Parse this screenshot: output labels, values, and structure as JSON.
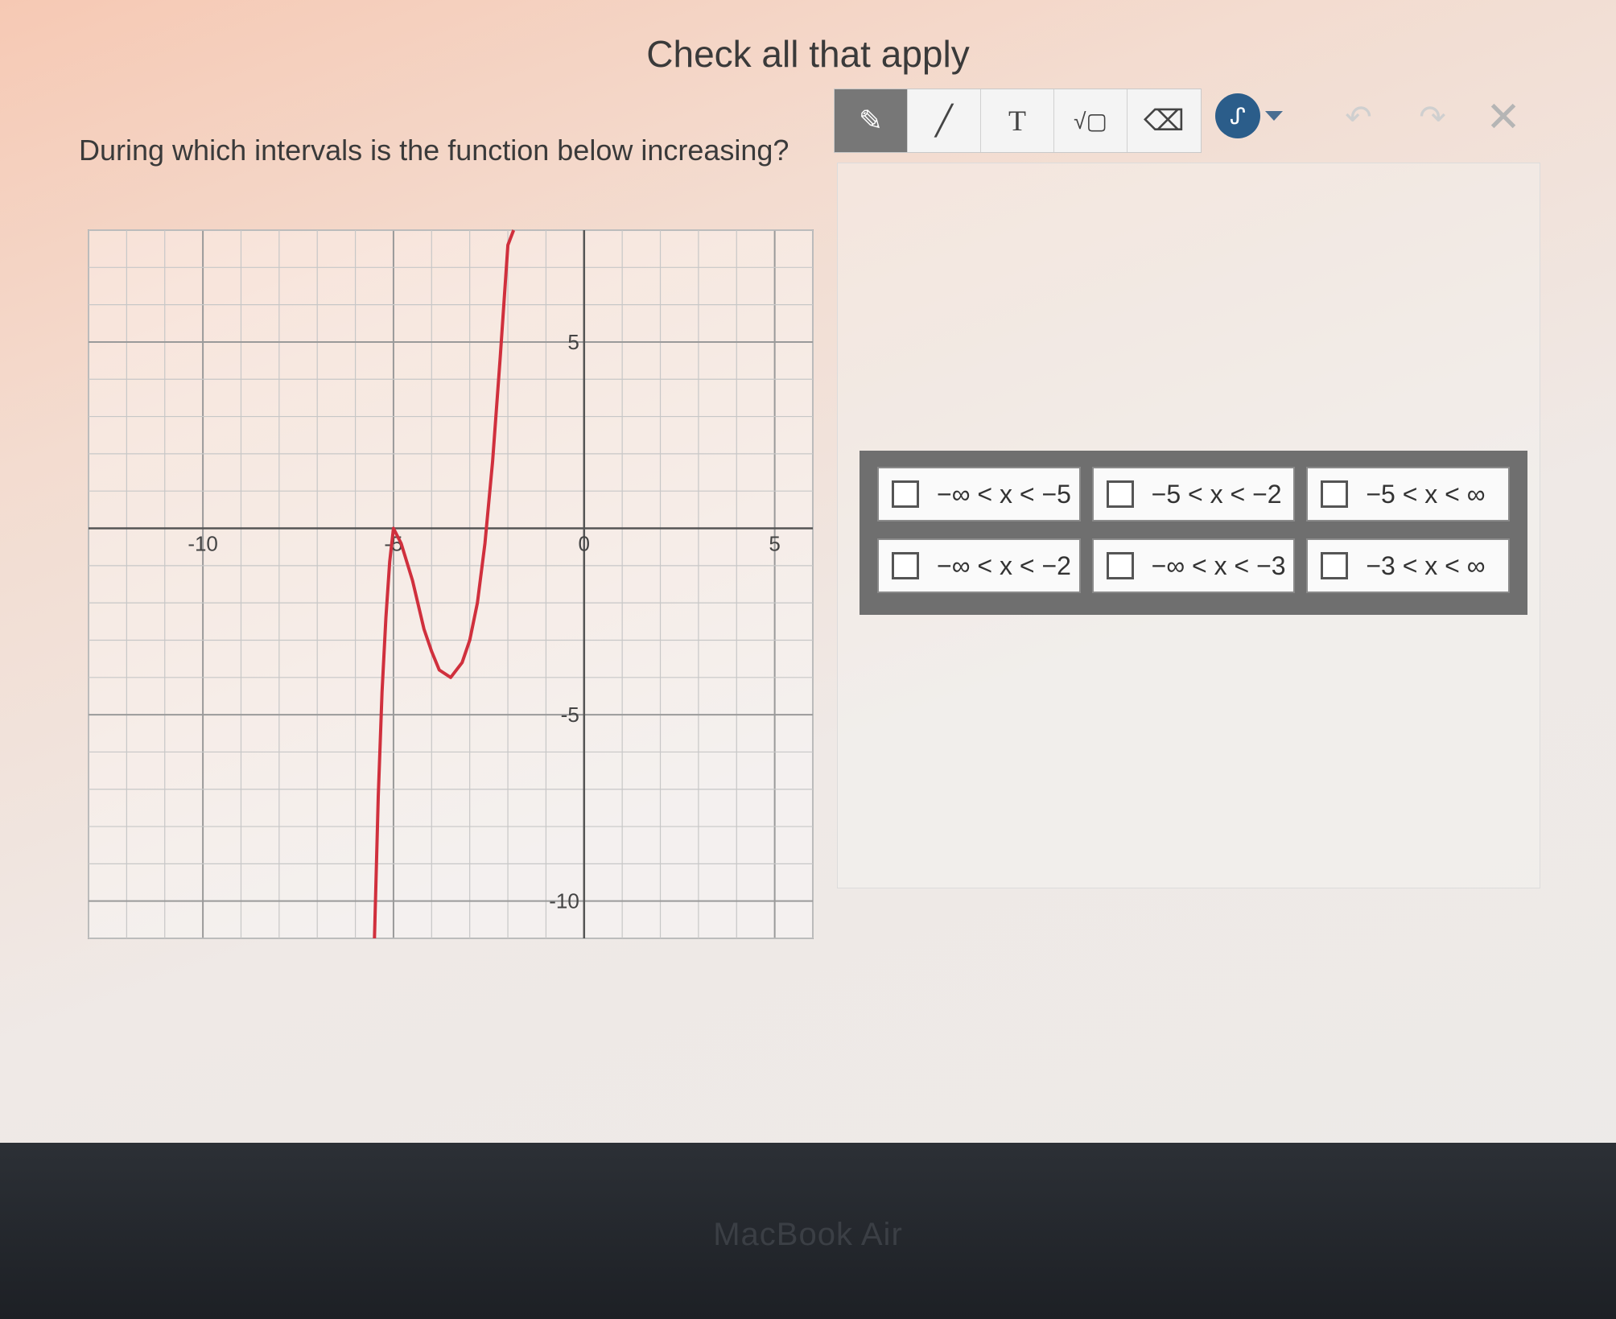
{
  "header": {
    "title": "Check all that apply"
  },
  "question": {
    "text": "During which intervals is the function below increasing?"
  },
  "toolbar": {
    "tools": [
      {
        "name": "pencil",
        "glyph": "✎"
      },
      {
        "name": "line",
        "glyph": "╱"
      },
      {
        "name": "text",
        "glyph": "T"
      },
      {
        "name": "equation",
        "glyph": "√▢"
      },
      {
        "name": "eraser",
        "glyph": "⌫"
      }
    ],
    "color_glyph": "ᔑ",
    "undo_glyph": "↶",
    "redo_glyph": "↷",
    "close_glyph": "✕"
  },
  "colors": {
    "curve": "#d0303d",
    "picker": "#2b5d8a"
  },
  "choices": [
    {
      "label": "−∞ < x < −5",
      "checked": false
    },
    {
      "label": "−5 < x < −2",
      "checked": false
    },
    {
      "label": "−5 < x < ∞",
      "checked": false
    },
    {
      "label": "−∞ < x < −2",
      "checked": false
    },
    {
      "label": "−∞ < x < −3",
      "checked": false
    },
    {
      "label": "−3 < x < ∞",
      "checked": false
    }
  ],
  "chart_data": {
    "type": "line",
    "xlim": [
      -13,
      6
    ],
    "ylim": [
      -11,
      8
    ],
    "grid": true,
    "x_ticks": [
      -10,
      -5,
      0,
      5
    ],
    "y_ticks": [
      5,
      -5,
      -10
    ],
    "x_tick_labels": [
      "-10",
      "-5",
      "0",
      "5"
    ],
    "y_tick_labels": [
      "5",
      "-5",
      "-10"
    ],
    "series": [
      {
        "x": [
          -5.5,
          -5.4,
          -5.3,
          -5.2,
          -5.1,
          -5.0,
          -4.8,
          -4.5,
          -4.2,
          -4.0,
          -3.8,
          -3.5,
          -3.2,
          -3.0,
          -2.8,
          -2.6,
          -2.4,
          -2.2,
          -2.0,
          -1.85
        ],
        "y": [
          -11,
          -7.2,
          -4.4,
          -2.4,
          -0.9,
          0,
          -0.4,
          -1.4,
          -2.7,
          -3.3,
          -3.8,
          -4.0,
          -3.6,
          -3.0,
          -2.0,
          -0.4,
          1.8,
          4.6,
          7.6,
          10
        ]
      }
    ]
  },
  "footer": {
    "bezel_label": "MacBook Air"
  }
}
